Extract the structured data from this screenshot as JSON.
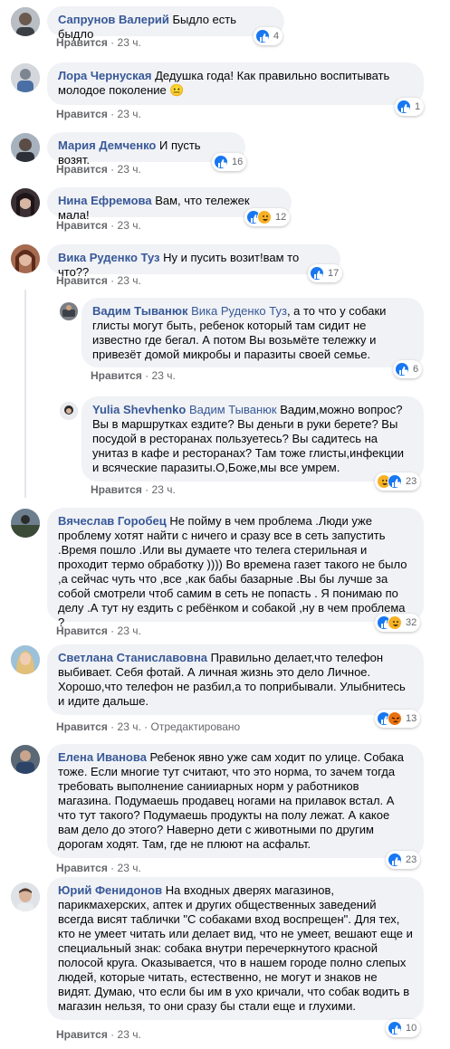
{
  "colors": {
    "name": "#385898",
    "bubble": "#f0f2f5",
    "meta": "#65676b",
    "like_blue": "#1877f2"
  },
  "common": {
    "like_label": "Нравится",
    "dot": "·",
    "time": "23 ч."
  },
  "comments": [
    {
      "name": "Сапрунов Валерий",
      "text": "Быдло есть быдло",
      "reactions": [
        "like-icon"
      ],
      "count": "4"
    },
    {
      "name": "Лора Чернуская",
      "text": "Дедушка года! Как правильно воспитывать молодое поколение 😐",
      "reactions": [
        "like-icon"
      ],
      "count": "1"
    },
    {
      "name": "Мария Демченко",
      "text": "И пусть возят.",
      "reactions": [
        "like-icon"
      ],
      "count": "16"
    },
    {
      "name": "Нина Ефремова",
      "text": "Вам, что тележек мала!",
      "reactions": [
        "like-icon",
        "haha-icon"
      ],
      "count": "12"
    },
    {
      "name": "Вика Руденко Туз",
      "text": "Ну и пусить возит!вам то что??",
      "reactions": [
        "like-icon"
      ],
      "count": "17"
    },
    {
      "name": "Вадим Тыванюк",
      "mention": "Вика Руденко Туз",
      "text": ", а то что у собаки глисты могут быть, ребенок который там сидит не известно где бегал. А потом Вы возьмёте тележку и привезёт домой микробы и паразиты своей семье.",
      "reactions": [
        "like-icon"
      ],
      "count": "6"
    },
    {
      "name": "Yulia Shevhenko",
      "mention": "Вадим Тыванюк",
      "text": "Вадим,можно вопрос? Вы в маршрутках ездите? Вы деньги в руки берете? Вы посудой в ресторанах пользуетесь? Вы садитесь на унитаз в кафе и ресторанах? Там тоже глисты,инфекции и всяческие паразиты.О,Боже,мы все умрем.",
      "reactions": [
        "haha-icon",
        "like-icon"
      ],
      "count": "23"
    },
    {
      "name": "Вячеслав Горобец",
      "text": "Не пойму в чем проблема .Люди уже проблему хотят найти с ничего и сразу все в сеть запустить .Время пошло .Или вы думаете что телега стерильная и проходит термо обработку )))) Во времена газет такого не было ,а сейчас чуть что ,все ,как бабы базарные .Вы бы лучше за собой смотрели чтоб самим в сеть не попасть . Я понимаю по делу .А тут ну ездить с ребёнком и собакой ,ну в чем проблема ?",
      "reactions": [
        "like-icon",
        "haha-icon"
      ],
      "count": "32"
    },
    {
      "name": "Светлана Станиславовна",
      "text": "Правильно делает,что телефон выбивает. Себя фотай. А личная жизнь это дело Личное. Хорошо,что телефон не разбил,а то поприбывали. Улыбнитесь и идите дальше.",
      "reactions": [
        "like-icon",
        "angry-icon"
      ],
      "count": "13",
      "edited": "Отредактировано"
    },
    {
      "name": "Елена Иванова",
      "text": "Ребенок явно уже сам ходит по улице. Собака тоже. Если многие тут считают, что это норма, то зачем тогда требовать выполнение санииарных норм у работников магазина. Подумаешь продавец ногами на прилавок встал. А что тут такого? Подумаешь продукты на полу лежат. А какое вам дело до этого? Наверно дети с животными по другим дорогам ходят. Там, где не плюют на асфальт.",
      "reactions": [
        "like-icon"
      ],
      "count": "23"
    },
    {
      "name": "Юрий Фенидонов",
      "text": "На входных дверях магазинов, парикмахерских, аптек и других общественных заведений всегда висят таблички \"С собаками вход воспрещен\". Для тех, кто не умеет читать или делает вид, что не умеет, вешают еще и специальный знак: собака внутри перечеркнутого красной полосой круга. Оказывается, что в нашем городе полно слепых людей, которые читать, естественно, не могут и знаков не видят. Думаю, что если бы им в ухо кричали, что собак водить в магазин нельзя, то они сразу бы стали еще и глухими.",
      "reactions": [
        "like-icon"
      ],
      "count": "10"
    }
  ]
}
